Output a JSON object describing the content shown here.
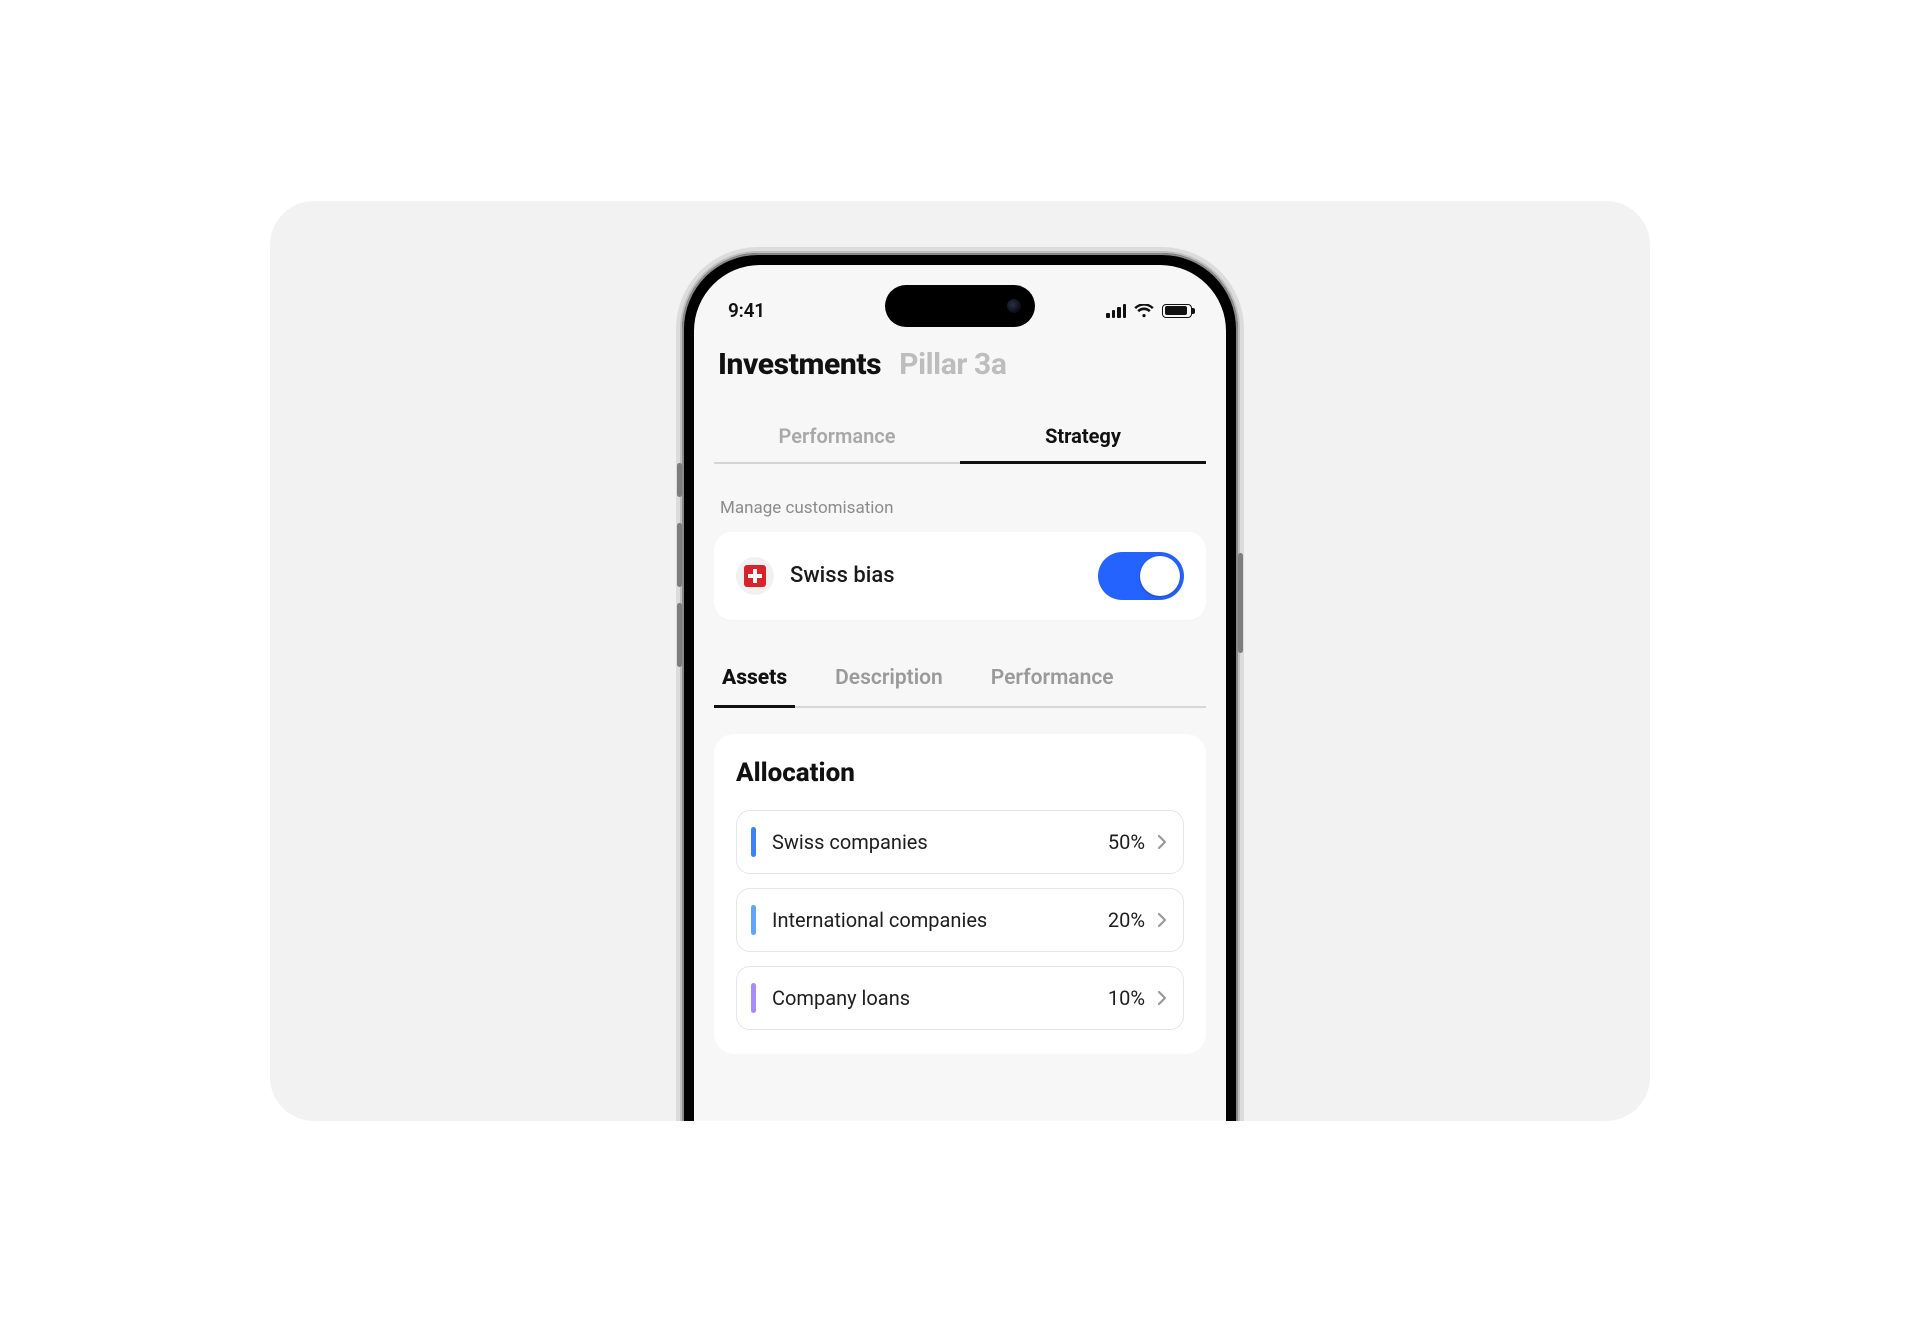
{
  "status_bar": {
    "time": "9:41"
  },
  "header": {
    "tabs": [
      {
        "label": "Investments",
        "active": true
      },
      {
        "label": "Pillar 3a",
        "active": false
      }
    ]
  },
  "top_tabs": [
    {
      "label": "Performance",
      "active": false
    },
    {
      "label": "Strategy",
      "active": true
    }
  ],
  "customisation": {
    "section_label": "Manage customisation",
    "item_label": "Swiss bias",
    "toggle_on": true
  },
  "sub_tabs": [
    {
      "label": "Assets",
      "active": true
    },
    {
      "label": "Description",
      "active": false
    },
    {
      "label": "Performance",
      "active": false
    }
  ],
  "allocation": {
    "title": "Allocation",
    "rows": [
      {
        "name": "Swiss companies",
        "pct": "50%",
        "color": "#3b82f6"
      },
      {
        "name": "International companies",
        "pct": "20%",
        "color": "#60a5fa"
      },
      {
        "name": "Company loans",
        "pct": "10%",
        "color": "#a78bfa"
      }
    ]
  },
  "colors": {
    "accent_toggle": "#2563ff"
  }
}
